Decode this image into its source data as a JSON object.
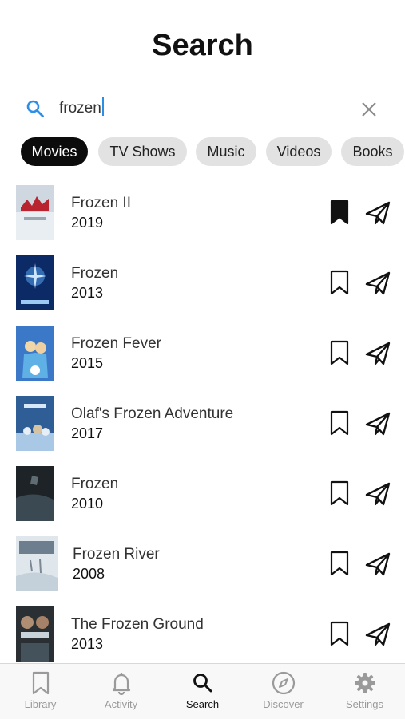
{
  "header": {
    "title": "Search"
  },
  "search": {
    "query": "frozen",
    "icon": "search-icon",
    "clear_icon": "close-icon",
    "accent": "#2d8ee8"
  },
  "filters": [
    {
      "label": "Movies",
      "active": true
    },
    {
      "label": "TV Shows",
      "active": false
    },
    {
      "label": "Music",
      "active": false
    },
    {
      "label": "Videos",
      "active": false
    },
    {
      "label": "Books",
      "active": false
    }
  ],
  "results": [
    {
      "title": "Frozen II",
      "year": "2019",
      "bookmarked": true
    },
    {
      "title": "Frozen",
      "year": "2013",
      "bookmarked": false
    },
    {
      "title": "Frozen Fever",
      "year": "2015",
      "bookmarked": false
    },
    {
      "title": "Olaf's Frozen Adventure",
      "year": "2017",
      "bookmarked": false
    },
    {
      "title": "Frozen",
      "year": "2010",
      "bookmarked": false
    },
    {
      "title": "Frozen River",
      "year": "2008",
      "bookmarked": false
    },
    {
      "title": "The Frozen Ground",
      "year": "2013",
      "bookmarked": false
    }
  ],
  "tabbar": {
    "items": [
      {
        "label": "Library",
        "icon": "bookmark-icon",
        "active": false
      },
      {
        "label": "Activity",
        "icon": "bell-icon",
        "active": false
      },
      {
        "label": "Search",
        "icon": "search-icon",
        "active": true
      },
      {
        "label": "Discover",
        "icon": "compass-icon",
        "active": false
      },
      {
        "label": "Settings",
        "icon": "gear-icon",
        "active": false
      }
    ]
  }
}
